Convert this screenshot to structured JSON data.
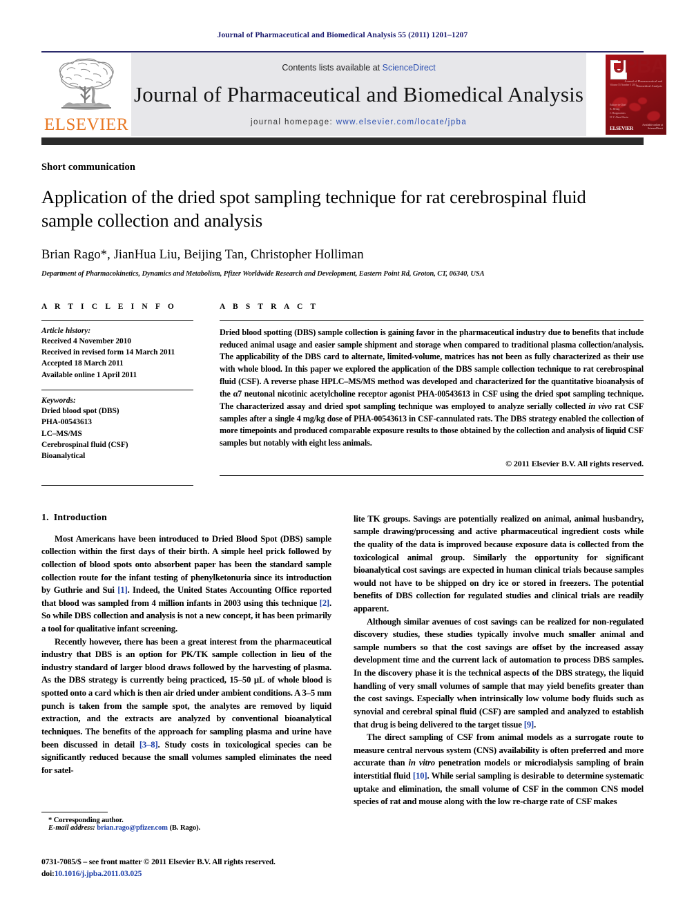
{
  "running_head": "Journal of Pharmaceutical and Biomedical Analysis 55 (2011) 1201–1207",
  "masthead": {
    "contents_prefix": "Contents lists available at ",
    "sciencedirect": "ScienceDirect",
    "journal_name": "Journal of Pharmaceutical and Biomedical Analysis",
    "homepage_label": "journal homepage: ",
    "homepage_url": "www.elsevier.com/locate/jpba",
    "publisher_wordmark": "ELSEVIER",
    "accent_orange": "#E87722",
    "accent_blue": "#2b4eb0",
    "band_gray": "#e7e7ea"
  },
  "cover": {
    "title_abbrev": "JPBA",
    "subtitle": "Journal of Pharmaceutical and Biomedical Analysis",
    "vertical_text": "Volume 55 Number 5 2011",
    "footer_text": "Editors-in-Chief\nK. Heinig\nJ. Hoogmartens\nH. Y. Aboul-Enein",
    "publisher": "ELSEVIER",
    "sciencedirect": "Available online at\nScienceDirect",
    "bg_color": "#8d0f15"
  },
  "article": {
    "kicker": "Short communication",
    "title": "Application of the dried spot sampling technique for rat cerebrospinal fluid sample collection and analysis",
    "authors": "Brian Rago*, JianHua Liu, Beijing Tan, Christopher Holliman",
    "affiliation": "Department of Pharmacokinetics, Dynamics and Metabolism, Pfizer Worldwide Research and Development, Eastern Point Rd, Groton, CT, 06340, USA"
  },
  "info": {
    "heading": "A R T I C L E   I N F O",
    "history_label": "Article history:",
    "history": [
      "Received 4 November 2010",
      "Received in revised form 14 March 2011",
      "Accepted 18 March 2011",
      "Available online 1 April 2011"
    ],
    "keywords_label": "Keywords:",
    "keywords": [
      "Dried blood spot (DBS)",
      "PHA-00543613",
      "LC–MS/MS",
      "Cerebrospinal fluid (CSF)",
      "Bioanalytical"
    ]
  },
  "abstract": {
    "heading": "A B S T R A C T",
    "text": "Dried blood spotting (DBS) sample collection is gaining favor in the pharmaceutical industry due to benefits that include reduced animal usage and easier sample shipment and storage when compared to traditional plasma collection/analysis. The applicability of the DBS card to alternate, limited-volume, matrices has not been as fully characterized as their use with whole blood. In this paper we explored the application of the DBS sample collection technique to rat cerebrospinal fluid (CSF). A reverse phase HPLC–MS/MS method was developed and characterized for the quantitative bioanalysis of the α7 neutonal nicotinic acetylcholine receptor agonist PHA-00543613 in CSF using the dried spot sampling technique. The characterized assay and dried spot sampling technique was employed to analyze serially collected in vivo rat CSF samples after a single 4 mg/kg dose of PHA-00543613 in CSF-cannulated rats. The DBS strategy enabled the collection of more timepoints and produced comparable exposure results to those obtained by the collection and analysis of liquid CSF samples but notably with eight less animals.",
    "copyright": "© 2011 Elsevier B.V. All rights reserved."
  },
  "introduction": {
    "number": "1.",
    "heading": "Introduction",
    "left_paragraphs": [
      "Most Americans have been introduced to Dried Blood Spot (DBS) sample collection within the first days of their birth. A simple heel prick followed by collection of blood spots onto absorbent paper has been the standard sample collection route for the infant testing of phenylketonuria since its introduction by Guthrie and Sui [1]. Indeed, the United States Accounting Office reported that blood was sampled from 4 million infants in 2003 using this technique [2]. So while DBS collection and analysis is not a new concept, it has been primarily a tool for qualitative infant screening.",
      "Recently however, there has been a great interest from the pharmaceutical industry that DBS is an option for PK/TK sample collection in lieu of the industry standard of larger blood draws followed by the harvesting of plasma. As the DBS strategy is currently being practiced, 15–50 μL of whole blood is spotted onto a card which is then air dried under ambient conditions. A 3–5 mm punch is taken from the sample spot, the analytes are removed by liquid extraction, and the extracts are analyzed by conventional bioanalytical techniques. The benefits of the approach for sampling plasma and urine have been discussed in detail [3–8]. Study costs in toxicological species can be significantly reduced because the small volumes sampled eliminates the need for satel-"
    ],
    "right_paragraphs": [
      "lite TK groups. Savings are potentially realized on animal, animal husbandry, sample drawing/processing and active pharmaceutical ingredient costs while the quality of the data is improved because exposure data is collected from the toxicological animal group. Similarly the opportunity for significant bioanalytical cost savings are expected in human clinical trials because samples would not have to be shipped on dry ice or stored in freezers. The potential benefits of DBS collection for regulated studies and clinical trials are readily apparent.",
      "Although similar avenues of cost savings can be realized for non-regulated discovery studies, these studies typically involve much smaller animal and sample numbers so that the cost savings are offset by the increased assay development time and the current lack of automation to process DBS samples. In the discovery phase it is the technical aspects of the DBS strategy, the liquid handling of very small volumes of sample that may yield benefits greater than the cost savings. Especially when intrinsically low volume body fluids such as synovial and cerebral spinal fluid (CSF) are sampled and analyzed to establish that drug is being delivered to the target tissue [9].",
      "The direct sampling of CSF from animal models as a surrogate route to measure central nervous system (CNS) availability is often preferred and more accurate than in vitro penetration models or microdialysis sampling of brain interstitial fluid [10]. While serial sampling is desirable to determine systematic uptake and elimination, the small volume of CSF in the common CNS model species of rat and mouse along with the low re-charge rate of CSF makes"
    ]
  },
  "footnote": {
    "corresponding": "* Corresponding author.",
    "email_label": "E-mail address:",
    "email": "brian.rago@pfizer.com",
    "email_owner": "(B. Rago)."
  },
  "footer": {
    "issn_line": "0731-7085/$ – see front matter © 2011 Elsevier B.V. All rights reserved.",
    "doi_label": "doi:",
    "doi": "10.1016/j.jpba.2011.03.025"
  }
}
